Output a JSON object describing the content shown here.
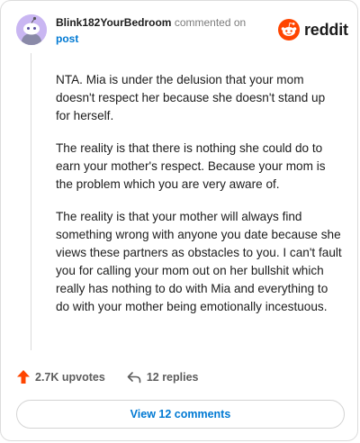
{
  "comment": {
    "username": "Blink182YourBedroom",
    "action_text": "commented on",
    "post_link": "post",
    "paragraphs": [
      "NTA. Mia is under the delusion that your mom doesn't respect her because she doesn't stand up for herself.",
      "The reality is that there is nothing she could do to earn your mother's respect. Because your mom is the problem which you are very aware of.",
      "The reality is that your mother will always find something wrong with anyone you date because she views these partners as obstacles to you. I can't fault you for calling your mom out on her bullshit which really has nothing to do with Mia and everything to do with your mother being emotionally incestuous."
    ]
  },
  "brand": {
    "logo_text": "reddit",
    "icon": "reddit-snoo-icon",
    "color": "#ff4500"
  },
  "actions": {
    "upvotes": "2.7K upvotes",
    "upvote_icon": "upvote-arrow-icon",
    "upvote_color": "#ff4500",
    "replies": "12 replies",
    "reply_icon": "reply-arrow-icon"
  },
  "footer": {
    "view_comments": "View 12 comments"
  },
  "colors": {
    "link": "#0079d3",
    "avatar_bg": "#c9b6f2"
  }
}
